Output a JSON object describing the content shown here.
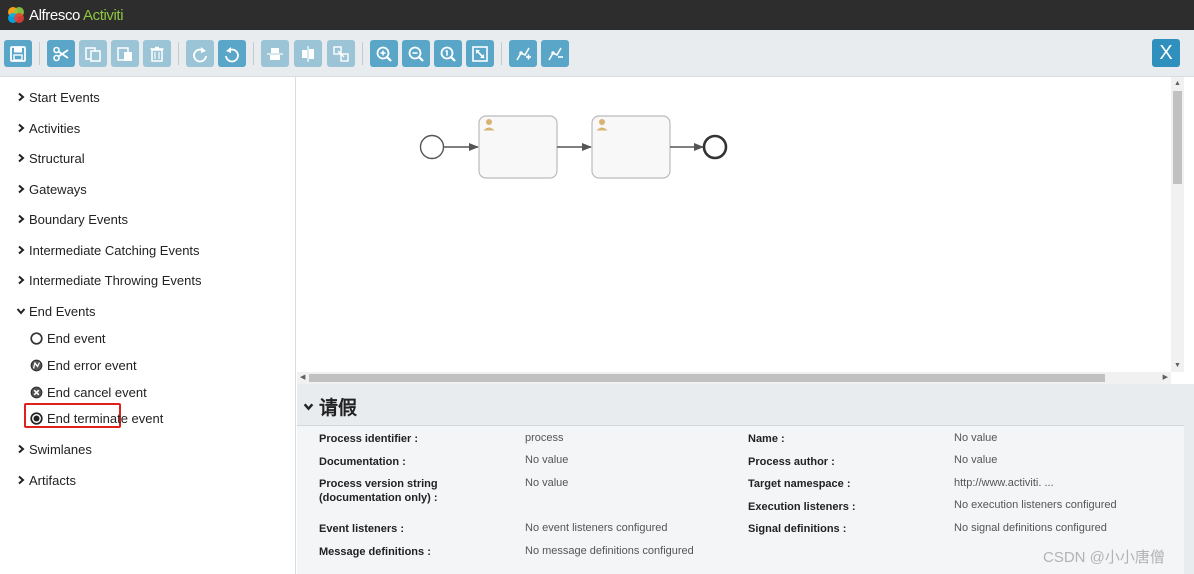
{
  "app": {
    "brand": "Alfresco",
    "product": "Activiti"
  },
  "toolbar": {
    "buttons": [
      {
        "name": "save-icon"
      },
      {
        "name": "cut-icon"
      },
      {
        "name": "copy-icon"
      },
      {
        "name": "paste-icon"
      },
      {
        "name": "delete-icon"
      },
      {
        "name": "redo-icon"
      },
      {
        "name": "undo-icon"
      },
      {
        "name": "align-horizontal-icon"
      },
      {
        "name": "align-vertical-icon"
      },
      {
        "name": "same-size-icon"
      },
      {
        "name": "zoom-in-icon"
      },
      {
        "name": "zoom-out-icon"
      },
      {
        "name": "zoom-actual-icon"
      },
      {
        "name": "zoom-fit-icon"
      },
      {
        "name": "add-bendpoint-icon"
      },
      {
        "name": "remove-bendpoint-icon"
      }
    ],
    "close_label": "X"
  },
  "palette": {
    "groups": [
      {
        "label": "Start Events",
        "expanded": false
      },
      {
        "label": "Activities",
        "expanded": false
      },
      {
        "label": "Structural",
        "expanded": false
      },
      {
        "label": "Gateways",
        "expanded": false
      },
      {
        "label": "Boundary Events",
        "expanded": false
      },
      {
        "label": "Intermediate Catching Events",
        "expanded": false
      },
      {
        "label": "Intermediate Throwing Events",
        "expanded": false
      },
      {
        "label": "End Events",
        "expanded": true
      },
      {
        "label": "Swimlanes",
        "expanded": false
      },
      {
        "label": "Artifacts",
        "expanded": false
      }
    ],
    "end_event_items": [
      {
        "label": "End event",
        "icon": "end-event-icon",
        "selected": true
      },
      {
        "label": "End error event",
        "icon": "end-error-event-icon"
      },
      {
        "label": "End cancel event",
        "icon": "end-cancel-event-icon"
      },
      {
        "label": "End terminate event",
        "icon": "end-terminate-event-icon"
      }
    ]
  },
  "canvas": {
    "elements": [
      "start-event",
      "user-task",
      "user-task",
      "end-event"
    ],
    "task_icon": "user-icon"
  },
  "properties": {
    "title": "请假",
    "left": [
      {
        "label": "Process identifier :",
        "value": "process"
      },
      {
        "label": "Documentation :",
        "value": "No value"
      },
      {
        "label": "Process version string (documentation only) :",
        "value": "No value"
      },
      {
        "label": "Event listeners :",
        "value": "No event listeners configured"
      },
      {
        "label": "Message definitions :",
        "value": "No message definitions configured"
      }
    ],
    "right": [
      {
        "label": "Name :",
        "value": "No value"
      },
      {
        "label": "Process author :",
        "value": "No value"
      },
      {
        "label": "Target namespace :",
        "value": "http://www.activiti. ..."
      },
      {
        "label": "Execution listeners :",
        "value": "No execution listeners configured"
      },
      {
        "label": "Signal definitions :",
        "value": "No signal definitions configured"
      }
    ]
  },
  "watermark": "CSDN @小小唐僧",
  "colors": {
    "header": "#2d2d2d",
    "toolbar_button": "#59a6c9",
    "highlight": "#e0211b",
    "brand_accent": "#8dc63f"
  }
}
